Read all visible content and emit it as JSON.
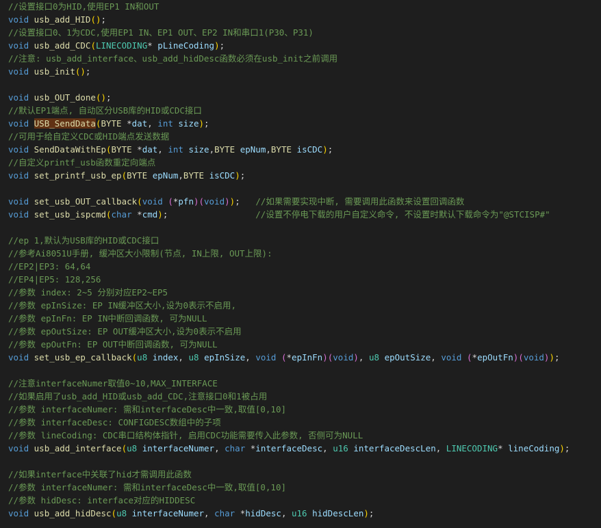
{
  "code_lines": [
    [
      {
        "t": "//设置接口0为HID,使用EP1 IN和OUT",
        "k": "comment"
      }
    ],
    [
      {
        "t": "void",
        "k": "keyword"
      },
      {
        "t": " "
      },
      {
        "t": "usb_add_HID",
        "k": "func"
      },
      {
        "t": "()",
        "k": "paren"
      },
      {
        "t": ";"
      }
    ],
    [
      {
        "t": "//设置接口0、1为CDC,使用EP1 IN、EP1 OUT、EP2 IN和串口1(P30、P31)",
        "k": "comment"
      }
    ],
    [
      {
        "t": "void",
        "k": "keyword"
      },
      {
        "t": " "
      },
      {
        "t": "usb_add_CDC",
        "k": "func"
      },
      {
        "t": "(",
        "k": "paren"
      },
      {
        "t": "LINECODING",
        "k": "type"
      },
      {
        "t": "* "
      },
      {
        "t": "pLineCoding",
        "k": "param"
      },
      {
        "t": ")",
        "k": "paren"
      },
      {
        "t": ";"
      }
    ],
    [
      {
        "t": "//注意: usb_add_interface、usb_add_hidDesc函数必须在usb_init之前调用",
        "k": "comment"
      }
    ],
    [
      {
        "t": "void",
        "k": "keyword"
      },
      {
        "t": " "
      },
      {
        "t": "usb_init",
        "k": "func"
      },
      {
        "t": "()",
        "k": "paren"
      },
      {
        "t": ";"
      }
    ],
    [],
    [
      {
        "t": "void",
        "k": "keyword"
      },
      {
        "t": " "
      },
      {
        "t": "usb_OUT_done",
        "k": "func"
      },
      {
        "t": "()",
        "k": "paren"
      },
      {
        "t": ";"
      }
    ],
    [
      {
        "t": "//默认EP1端点, 自动区分USB库的HID或CDC接口",
        "k": "comment"
      }
    ],
    [
      {
        "t": "void",
        "k": "keyword"
      },
      {
        "t": " "
      },
      {
        "t": "USB_SendData",
        "k": "highlight"
      },
      {
        "t": "(",
        "k": "paren"
      },
      {
        "t": "BYTE",
        "k": "func"
      },
      {
        "t": " *"
      },
      {
        "t": "dat",
        "k": "param"
      },
      {
        "t": ", "
      },
      {
        "t": "int",
        "k": "keyword"
      },
      {
        "t": " "
      },
      {
        "t": "size",
        "k": "param"
      },
      {
        "t": ")",
        "k": "paren"
      },
      {
        "t": ";"
      }
    ],
    [
      {
        "t": "//可用于给自定义CDC或HID端点发送数据",
        "k": "comment"
      }
    ],
    [
      {
        "t": "void",
        "k": "keyword"
      },
      {
        "t": " "
      },
      {
        "t": "SendDataWithEp",
        "k": "func"
      },
      {
        "t": "(",
        "k": "paren"
      },
      {
        "t": "BYTE",
        "k": "func"
      },
      {
        "t": " *"
      },
      {
        "t": "dat",
        "k": "param"
      },
      {
        "t": ", "
      },
      {
        "t": "int",
        "k": "keyword"
      },
      {
        "t": " "
      },
      {
        "t": "size",
        "k": "param"
      },
      {
        "t": ","
      },
      {
        "t": "BYTE",
        "k": "func"
      },
      {
        "t": " "
      },
      {
        "t": "epNum",
        "k": "param"
      },
      {
        "t": ","
      },
      {
        "t": "BYTE",
        "k": "func"
      },
      {
        "t": " "
      },
      {
        "t": "isCDC",
        "k": "param"
      },
      {
        "t": ")",
        "k": "paren"
      },
      {
        "t": ";"
      }
    ],
    [
      {
        "t": "//自定义printf_usb函数重定向端点",
        "k": "comment"
      }
    ],
    [
      {
        "t": "void",
        "k": "keyword"
      },
      {
        "t": " "
      },
      {
        "t": "set_printf_usb_ep",
        "k": "func"
      },
      {
        "t": "(",
        "k": "paren"
      },
      {
        "t": "BYTE",
        "k": "func"
      },
      {
        "t": " "
      },
      {
        "t": "epNum",
        "k": "param"
      },
      {
        "t": ","
      },
      {
        "t": "BYTE",
        "k": "func"
      },
      {
        "t": " "
      },
      {
        "t": "isCDC",
        "k": "param"
      },
      {
        "t": ")",
        "k": "paren"
      },
      {
        "t": ";"
      }
    ],
    [],
    [
      {
        "t": "void",
        "k": "keyword"
      },
      {
        "t": " "
      },
      {
        "t": "set_usb_OUT_callback",
        "k": "func"
      },
      {
        "t": "(",
        "k": "paren"
      },
      {
        "t": "void",
        "k": "keyword"
      },
      {
        "t": " "
      },
      {
        "t": "(",
        "k": "paren2"
      },
      {
        "t": "*"
      },
      {
        "t": "pfn",
        "k": "param"
      },
      {
        "t": ")",
        "k": "paren2"
      },
      {
        "t": "(",
        "k": "paren2"
      },
      {
        "t": "void",
        "k": "keyword"
      },
      {
        "t": ")",
        "k": "paren2"
      },
      {
        "t": ")",
        "k": "paren"
      },
      {
        "t": ";   "
      },
      {
        "t": "//如果需要实现中断, 需要调用此函数来设置回调函数",
        "k": "comment"
      }
    ],
    [
      {
        "t": "void",
        "k": "keyword"
      },
      {
        "t": " "
      },
      {
        "t": "set_usb_ispcmd",
        "k": "func"
      },
      {
        "t": "(",
        "k": "paren"
      },
      {
        "t": "char",
        "k": "keyword"
      },
      {
        "t": " *"
      },
      {
        "t": "cmd",
        "k": "param"
      },
      {
        "t": ")",
        "k": "paren"
      },
      {
        "t": ";                 "
      },
      {
        "t": "//设置不停电下载的用户自定义命令, 不设置时默认下载命令为\"@STCISP#\"",
        "k": "comment"
      }
    ],
    [],
    [
      {
        "t": "//ep 1,默认为USB库的HID或CDC接口",
        "k": "comment"
      }
    ],
    [
      {
        "t": "//参考Ai8051U手册, 缓冲区大小限制(节点, IN上限, OUT上限):",
        "k": "comment"
      }
    ],
    [
      {
        "t": "//EP2|EP3: 64,64",
        "k": "comment"
      }
    ],
    [
      {
        "t": "//EP4|EP5: 128,256",
        "k": "comment"
      }
    ],
    [
      {
        "t": "//参数 index: 2~5 分别对应EP2~EP5",
        "k": "comment"
      }
    ],
    [
      {
        "t": "//参数 epInSize: EP IN缓冲区大小,设为0表示不启用,",
        "k": "comment"
      }
    ],
    [
      {
        "t": "//参数 epInFn: EP IN中断回调函数, 可为NULL",
        "k": "comment"
      }
    ],
    [
      {
        "t": "//参数 epOutSize: EP OUT缓冲区大小,设为0表示不启用",
        "k": "comment"
      }
    ],
    [
      {
        "t": "//参数 epOutFn: EP OUT中断回调函数, 可为NULL",
        "k": "comment"
      }
    ],
    [
      {
        "t": "void",
        "k": "keyword"
      },
      {
        "t": " "
      },
      {
        "t": "set_usb_ep_callback",
        "k": "func"
      },
      {
        "t": "(",
        "k": "paren"
      },
      {
        "t": "u8",
        "k": "type"
      },
      {
        "t": " "
      },
      {
        "t": "index",
        "k": "param"
      },
      {
        "t": ", "
      },
      {
        "t": "u8",
        "k": "type"
      },
      {
        "t": " "
      },
      {
        "t": "epInSize",
        "k": "param"
      },
      {
        "t": ", "
      },
      {
        "t": "void",
        "k": "keyword"
      },
      {
        "t": " "
      },
      {
        "t": "(",
        "k": "paren2"
      },
      {
        "t": "*"
      },
      {
        "t": "epInFn",
        "k": "param"
      },
      {
        "t": ")",
        "k": "paren2"
      },
      {
        "t": "(",
        "k": "paren2"
      },
      {
        "t": "void",
        "k": "keyword"
      },
      {
        "t": ")",
        "k": "paren2"
      },
      {
        "t": ", "
      },
      {
        "t": "u8",
        "k": "type"
      },
      {
        "t": " "
      },
      {
        "t": "epOutSize",
        "k": "param"
      },
      {
        "t": ", "
      },
      {
        "t": "void",
        "k": "keyword"
      },
      {
        "t": " "
      },
      {
        "t": "(",
        "k": "paren2"
      },
      {
        "t": "*"
      },
      {
        "t": "epOutFn",
        "k": "param"
      },
      {
        "t": ")",
        "k": "paren2"
      },
      {
        "t": "(",
        "k": "paren2"
      },
      {
        "t": "void",
        "k": "keyword"
      },
      {
        "t": ")",
        "k": "paren2"
      },
      {
        "t": ")",
        "k": "paren"
      },
      {
        "t": ";"
      }
    ],
    [],
    [
      {
        "t": "//注意interfaceNumer取值0~10,MAX_INTERFACE",
        "k": "comment"
      }
    ],
    [
      {
        "t": "//如果启用了usb_add_HID或usb_add_CDC,注意接口0和1被占用",
        "k": "comment"
      }
    ],
    [
      {
        "t": "//参数 interfaceNumer: 需和interfaceDesc中一致,取值[0,10]",
        "k": "comment"
      }
    ],
    [
      {
        "t": "//参数 interfaceDesc: CONFIGDESC数组中的子项",
        "k": "comment"
      }
    ],
    [
      {
        "t": "//参数 lineCoding: CDC串口结构体指针, 启用CDC功能需要传入此参数, 否侧可为NULL",
        "k": "comment"
      }
    ],
    [
      {
        "t": "void",
        "k": "keyword"
      },
      {
        "t": " "
      },
      {
        "t": "usb_add_interface",
        "k": "func"
      },
      {
        "t": "(",
        "k": "paren"
      },
      {
        "t": "u8",
        "k": "type"
      },
      {
        "t": " "
      },
      {
        "t": "interfaceNumer",
        "k": "param"
      },
      {
        "t": ", "
      },
      {
        "t": "char",
        "k": "keyword"
      },
      {
        "t": " *"
      },
      {
        "t": "interfaceDesc",
        "k": "param"
      },
      {
        "t": ", "
      },
      {
        "t": "u16",
        "k": "type"
      },
      {
        "t": " "
      },
      {
        "t": "interfaceDescLen",
        "k": "param"
      },
      {
        "t": ", "
      },
      {
        "t": "LINECODING",
        "k": "type"
      },
      {
        "t": "* "
      },
      {
        "t": "lineCoding",
        "k": "param"
      },
      {
        "t": ")",
        "k": "paren"
      },
      {
        "t": ";"
      }
    ],
    [],
    [
      {
        "t": "//如果interface中关联了hid才需调用此函数",
        "k": "comment"
      }
    ],
    [
      {
        "t": "//参数 interfaceNumer: 需和interfaceDesc中一致,取值[0,10]",
        "k": "comment"
      }
    ],
    [
      {
        "t": "//参数 hidDesc: interface对应的HIDDESC",
        "k": "comment"
      }
    ],
    [
      {
        "t": "void",
        "k": "keyword"
      },
      {
        "t": " "
      },
      {
        "t": "usb_add_hidDesc",
        "k": "func"
      },
      {
        "t": "(",
        "k": "paren"
      },
      {
        "t": "u8",
        "k": "type"
      },
      {
        "t": " "
      },
      {
        "t": "interfaceNumer",
        "k": "param"
      },
      {
        "t": ", "
      },
      {
        "t": "char",
        "k": "keyword"
      },
      {
        "t": " *"
      },
      {
        "t": "hidDesc",
        "k": "param"
      },
      {
        "t": ", "
      },
      {
        "t": "u16",
        "k": "type"
      },
      {
        "t": " "
      },
      {
        "t": "hidDescLen",
        "k": "param"
      },
      {
        "t": ")",
        "k": "paren"
      },
      {
        "t": ";"
      }
    ]
  ],
  "colors": {
    "background": "#1e1e1e",
    "comment": "#6a9955",
    "keyword": "#569cd6",
    "type": "#4ec9b0",
    "function": "#dcdcaa",
    "parameter": "#9cdcfe",
    "bracket": "#ffd700",
    "bracket_nested": "#da70d6",
    "highlight_bg": "#613214"
  }
}
